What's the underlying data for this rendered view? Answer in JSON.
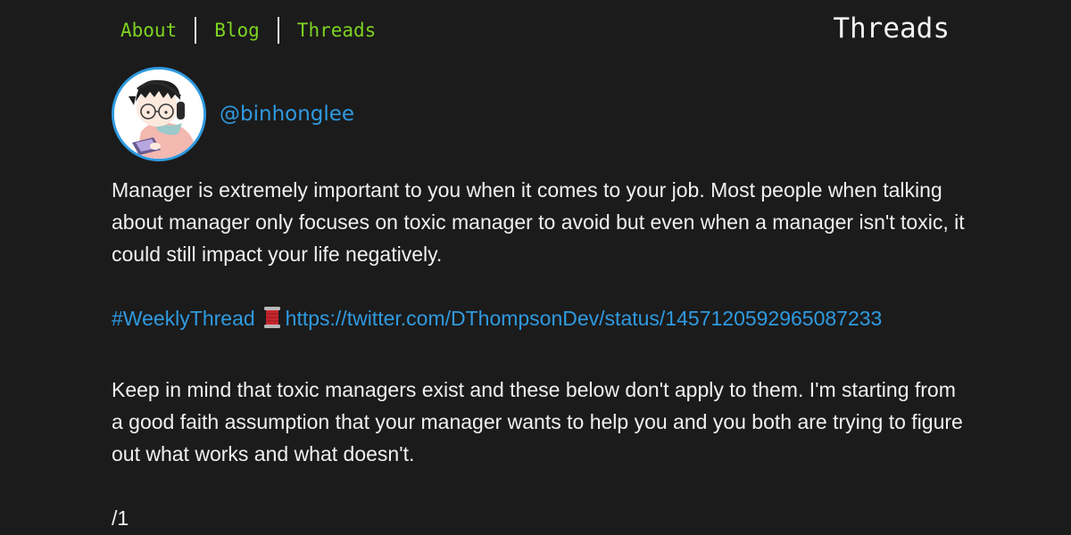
{
  "nav": {
    "items": [
      {
        "label": "About"
      },
      {
        "label": "Blog"
      },
      {
        "label": "Threads"
      }
    ],
    "page_heading": "Threads"
  },
  "profile": {
    "handle": "@binhonglee"
  },
  "post": {
    "paragraph_1": "Manager is extremely important to you when it comes to your job. Most people when talking about manager only focuses on toxic manager to avoid but even when a manager isn't toxic, it could still impact your life negatively.",
    "hashtag": "#WeeklyThread",
    "emoji_icon": "thread-spool-icon",
    "link": "https://twitter.com/DThompsonDev/status/1457120592965087233",
    "paragraph_2": "Keep in mind that toxic managers exist and these below don't apply to them. I'm starting from a good faith assumption that your manager wants to help you and you both are trying to figure out what works and what doesn't.",
    "counter": "/1"
  },
  "colors": {
    "background": "#1b1b1b",
    "nav_link": "#7ed321",
    "accent": "#2f9ae0",
    "text": "#f0f0f0"
  }
}
